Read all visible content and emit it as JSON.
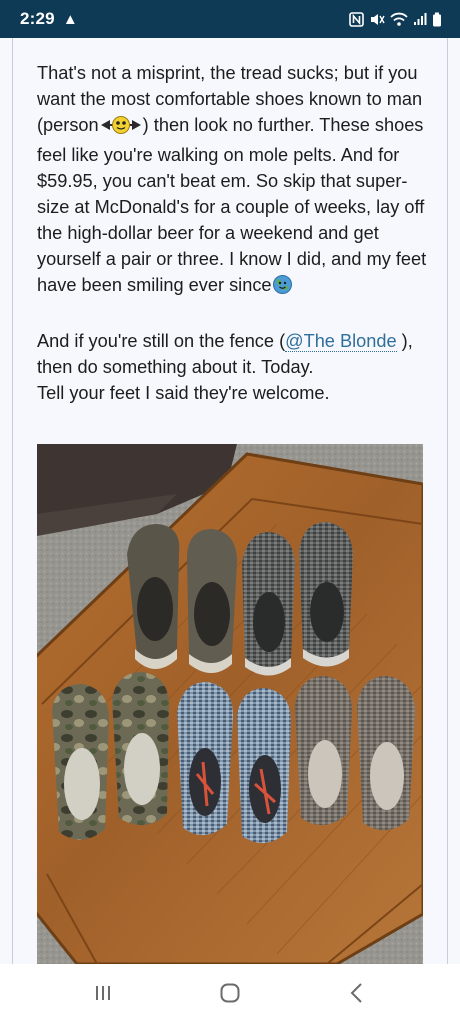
{
  "status_bar": {
    "time": "2:29",
    "alert_glyph": "▲",
    "icons": [
      "nfc-icon",
      "mute-icon",
      "wifi-icon",
      "signal-icon",
      "battery-icon"
    ]
  },
  "post": {
    "paragraph1_parts": {
      "a": "That's not a misprint, the tread sucks; but if you want the most comfortable shoes known to man (person",
      "b": ") then look no further. These shoes feel like you're walking on mole pelts. And for $59.95, you can't beat em. So skip that super-size at McDonald's for a couple of weeks, lay off the high-dollar beer for a weekend and get yourself a pair or three. I know I did, and my feet have been smiling ever since"
    },
    "paragraph2_parts": {
      "a": "And if you're still on the fence (",
      "mention": "@The Blonde",
      "b": " ),",
      "c": "then do something about it. Today."
    },
    "paragraph3": "Tell your feet I said they're welcome.",
    "emojis": [
      "candy-emoji-icon",
      "earth-emoji-icon"
    ]
  },
  "photo": {
    "subject": "shoes-photo",
    "colors": {
      "wood": "#a8672a",
      "carpet": "#9a9896",
      "couch": "#3e3532"
    }
  },
  "nav_bar": {
    "buttons": [
      "recent-apps-button",
      "home-button",
      "back-button"
    ]
  }
}
